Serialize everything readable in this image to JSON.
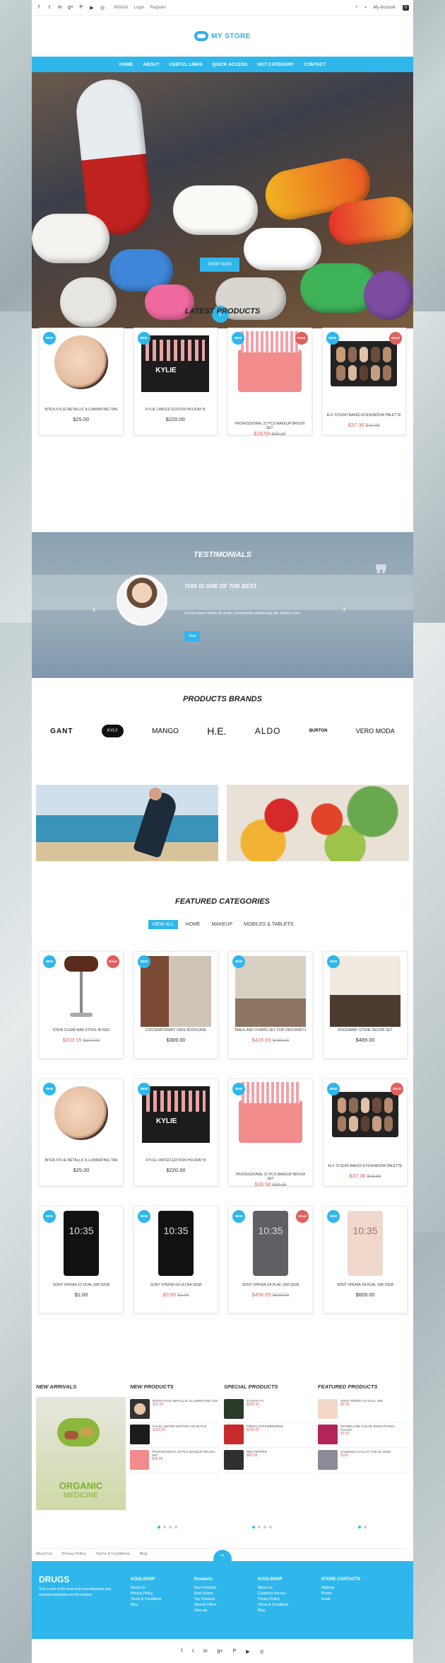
{
  "topbar": {
    "links": [
      "Wishlist",
      "Login",
      "Register"
    ],
    "account": "My Account",
    "cart_count": "0"
  },
  "logo": {
    "text": "MY STORE"
  },
  "nav": [
    "HOME",
    "ABOUT",
    "USEFUL LINKS",
    "QUICK ACCESS",
    "HOT CATEGORY",
    "CONTACT"
  ],
  "hero": {
    "button": "SHOP NOW"
  },
  "latest": {
    "title": "LATEST PRODUCTS",
    "items": [
      {
        "name": "BITEN KYLIE METALLIC ILLUMINATING TAN",
        "price": "$25.00",
        "badges": [
          "NEW"
        ]
      },
      {
        "name": "KYLIE LIMITED EDITION HOLIDAY B",
        "price": "$220.00",
        "badges": [
          "NEW"
        ]
      },
      {
        "name": "PROFESSIONAL 22 PCS MAKEUP BRUSH SET",
        "price": "$28.58",
        "old": "$30.19",
        "badges": [
          "NEW",
          "SALE"
        ]
      },
      {
        "name": "ELF STUDIO BAKED EYESHADOW PALETTE",
        "price": "$37.36",
        "old": "$43.98",
        "badges": [
          "NEW",
          "SALE"
        ]
      }
    ]
  },
  "testimonials": {
    "title": "TESTIMONIALS",
    "quote": "THIS IS ONE OF THE BEST",
    "text": "Lorem ipsum dolor sit amet, consectetur adipiscing elit. Donec eros",
    "button": "View"
  },
  "brands": {
    "title": "PRODUCTS BRANDS",
    "items": [
      "GANT",
      "KYLY",
      "MANGO",
      "H.E.",
      "ALDO",
      "BURTON",
      "VERO MODA"
    ]
  },
  "featured": {
    "title": "FEATURED CATEGORIES",
    "tabs": [
      "VIEW ALL",
      "HOME",
      "MAKEUP",
      "MOBILES & TABLETS"
    ],
    "items": [
      {
        "name": "STEIN CLEAR BAR STOOL IN RED",
        "price": "$203.15",
        "old": "$270.00",
        "badges": [
          "NEW",
          "SALE"
        ]
      },
      {
        "name": "CONTEMPORARY CAFE BOOKCASE",
        "price": "$389.00",
        "badges": [
          "NEW"
        ]
      },
      {
        "name": "TABLE AND CHAIRS SET FOR ZIRCONIA TL",
        "price": "$415.65",
        "old": "$489.00",
        "badges": [
          "NEW"
        ]
      },
      {
        "name": "ROCKAWAY STONE DECOR SET",
        "price": "$489.00",
        "badges": [
          "NEW"
        ]
      },
      {
        "name": "BITEN KYLIE METALLIC ILLUMINATING TAN",
        "price": "$25.00",
        "badges": [
          "NEW"
        ]
      },
      {
        "name": "KYLIE LIMITED EDITION HOLIDAY B",
        "price": "$220.00",
        "badges": [
          "NEW"
        ]
      },
      {
        "name": "PROFESSIONAL 22 PCS MAKEUP BRUSH SET",
        "price": "$28.58",
        "old": "$30.19",
        "badges": [
          "NEW"
        ]
      },
      {
        "name": "ELF STUDIO BAKED EYESHADOW PALETTE",
        "price": "$37.36",
        "old": "$43.98",
        "badges": [
          "NEW",
          "SALE"
        ]
      },
      {
        "name": "SONY XPERIA XZ DUAL SIM 32GB",
        "price": "$1.00",
        "badges": [
          "NEW"
        ]
      },
      {
        "name": "SONY XPERIA XA ULTRA 16GB",
        "price": "$0.85",
        "old": "$1.00",
        "badges": [
          "NEW"
        ]
      },
      {
        "name": "SONY XPERIA XA DUAL SIM 16GB",
        "price": "$456.65",
        "old": "$549.00",
        "badges": [
          "NEW",
          "SALE"
        ]
      },
      {
        "name": "SONY XPERIA XA DUAL SIM 16GB",
        "price": "$609.00",
        "badges": [
          "NEW"
        ]
      }
    ]
  },
  "bottom": {
    "new_arrivals": "NEW ARRIVALS",
    "organic": "ORGANIC",
    "medicine": "MEDICINE",
    "new_products": {
      "title": "NEW PRODUCTS",
      "items": [
        {
          "n": "BITEN KYLIE METALLIC ILLUMINATING TAN",
          "p": "$25.00"
        },
        {
          "n": "KYLIE LIMITED EDITION HOLIDAY B",
          "p": "$220.00"
        },
        {
          "n": "PROFESSIONAL 22 PCS MAKEUP BRUSH SET",
          "p": "$28.58"
        }
      ]
    },
    "special": {
      "title": "SPECIAL PRODUCTS",
      "items": [
        {
          "n": "24 INCH TV",
          "p": "$350.00"
        },
        {
          "n": "FRESH STRAWBERRIES",
          "p": "$295.00"
        },
        {
          "n": "RED PEPPER",
          "p": "$89.58"
        }
      ]
    },
    "featured": {
      "title": "FEATURED PRODUCTS",
      "items": [
        {
          "n": "SONY XPERIA XA DUAL SIM",
          "p": "$3.00"
        },
        {
          "n": "MAYBELLINE COLOR SENSATIONAL POLISH",
          "p": "$3.00"
        },
        {
          "n": "SAMSUNG GALAXY TAB S2 32GB",
          "p": "$100"
        }
      ]
    }
  },
  "footer_links": [
    "About Us",
    "Privacy Policy",
    "Terms & Conditions",
    "Blog"
  ],
  "footer": {
    "brand": "DRUGS",
    "desc": "This is one of the best and most attractive and smartest templates on the market.",
    "cols": [
      {
        "h": "KOOLSHOP",
        "items": [
          "About Us",
          "Privacy Policy",
          "Terms & Conditions",
          "Blog"
        ]
      },
      {
        "h": "Products",
        "items": [
          "New Products",
          "Best Sellers",
          "Top Products",
          "Special Offers",
          "Sitemap"
        ]
      },
      {
        "h": "KOOLSHOP",
        "items": [
          "About Us",
          "Customer Service",
          "Privacy Policy",
          "Terms & Conditions",
          "Blog"
        ]
      },
      {
        "h": "STORE CONTACTS",
        "items": [
          "Address",
          "Phone",
          "Email"
        ]
      }
    ]
  }
}
